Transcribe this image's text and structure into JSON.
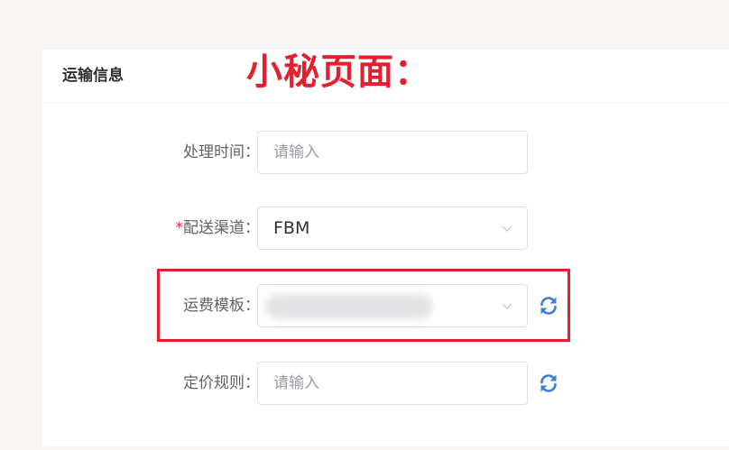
{
  "card": {
    "title": "运输信息"
  },
  "annotation": {
    "text": "小秘页面："
  },
  "form": {
    "processing_time": {
      "label": "处理时间：",
      "placeholder": "请输入"
    },
    "shipping_channel": {
      "required_mark": "*",
      "label": "配送渠道：",
      "value": "FBM"
    },
    "shipping_template": {
      "label": "运费模板："
    },
    "pricing_rule": {
      "label": "定价规则：",
      "placeholder": "请输入"
    }
  },
  "icons": {
    "dropdown": "chevron-down-icon",
    "refresh": "refresh-icon"
  },
  "colors": {
    "annotation": "#e5202e",
    "refresh_icon": "#3c7fd6",
    "label": "#606266"
  }
}
